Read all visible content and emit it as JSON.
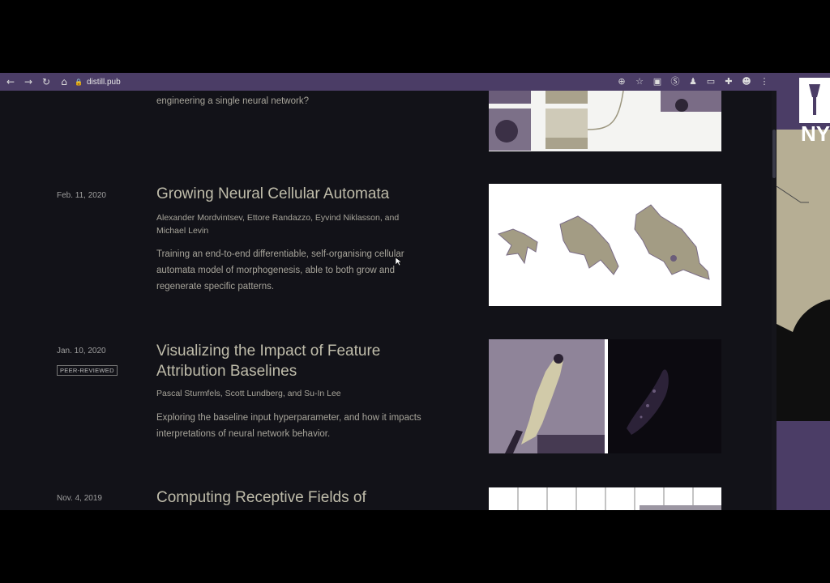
{
  "browser": {
    "url": "distill.pub",
    "nav": {
      "back": "←",
      "forward": "→",
      "reload": "↻",
      "home": "⌂"
    },
    "extension_icons": [
      "zoom-icon",
      "star-icon",
      "ext-icon",
      "s-icon",
      "person-icon",
      "tab-icon",
      "puzzle-icon",
      "profile-icon",
      "menu-icon"
    ]
  },
  "articles": [
    {
      "tail_text": "engineering a single neural network?"
    },
    {
      "date": "Feb. 11, 2020",
      "title": "Growing Neural Cellular Automata",
      "authors": "Alexander Mordvintsev, Ettore Randazzo, Eyvind Niklasson, and Michael Levin",
      "description": "Training an end-to-end differentiable, self-organising cellular automata model of morphogenesis, able to both grow and regenerate specific patterns."
    },
    {
      "date": "Jan. 10, 2020",
      "badge": "PEER-REVIEWED",
      "title": "Visualizing the Impact of Feature Attribution Baselines",
      "authors": "Pascal Sturmfels, Scott Lundberg, and Su-In Lee",
      "description": "Exploring the baseline input hyperparameter, and how it impacts interpretations of neural network behavior."
    },
    {
      "date": "Nov. 4, 2019",
      "title": "Computing Receptive Fields of"
    }
  ],
  "side_panel": {
    "logo_text": "NY"
  },
  "colors": {
    "toolbar": "#4b3d66",
    "page_bg": "#121218",
    "title": "#bfbcaa",
    "text": "#a7a49a"
  }
}
